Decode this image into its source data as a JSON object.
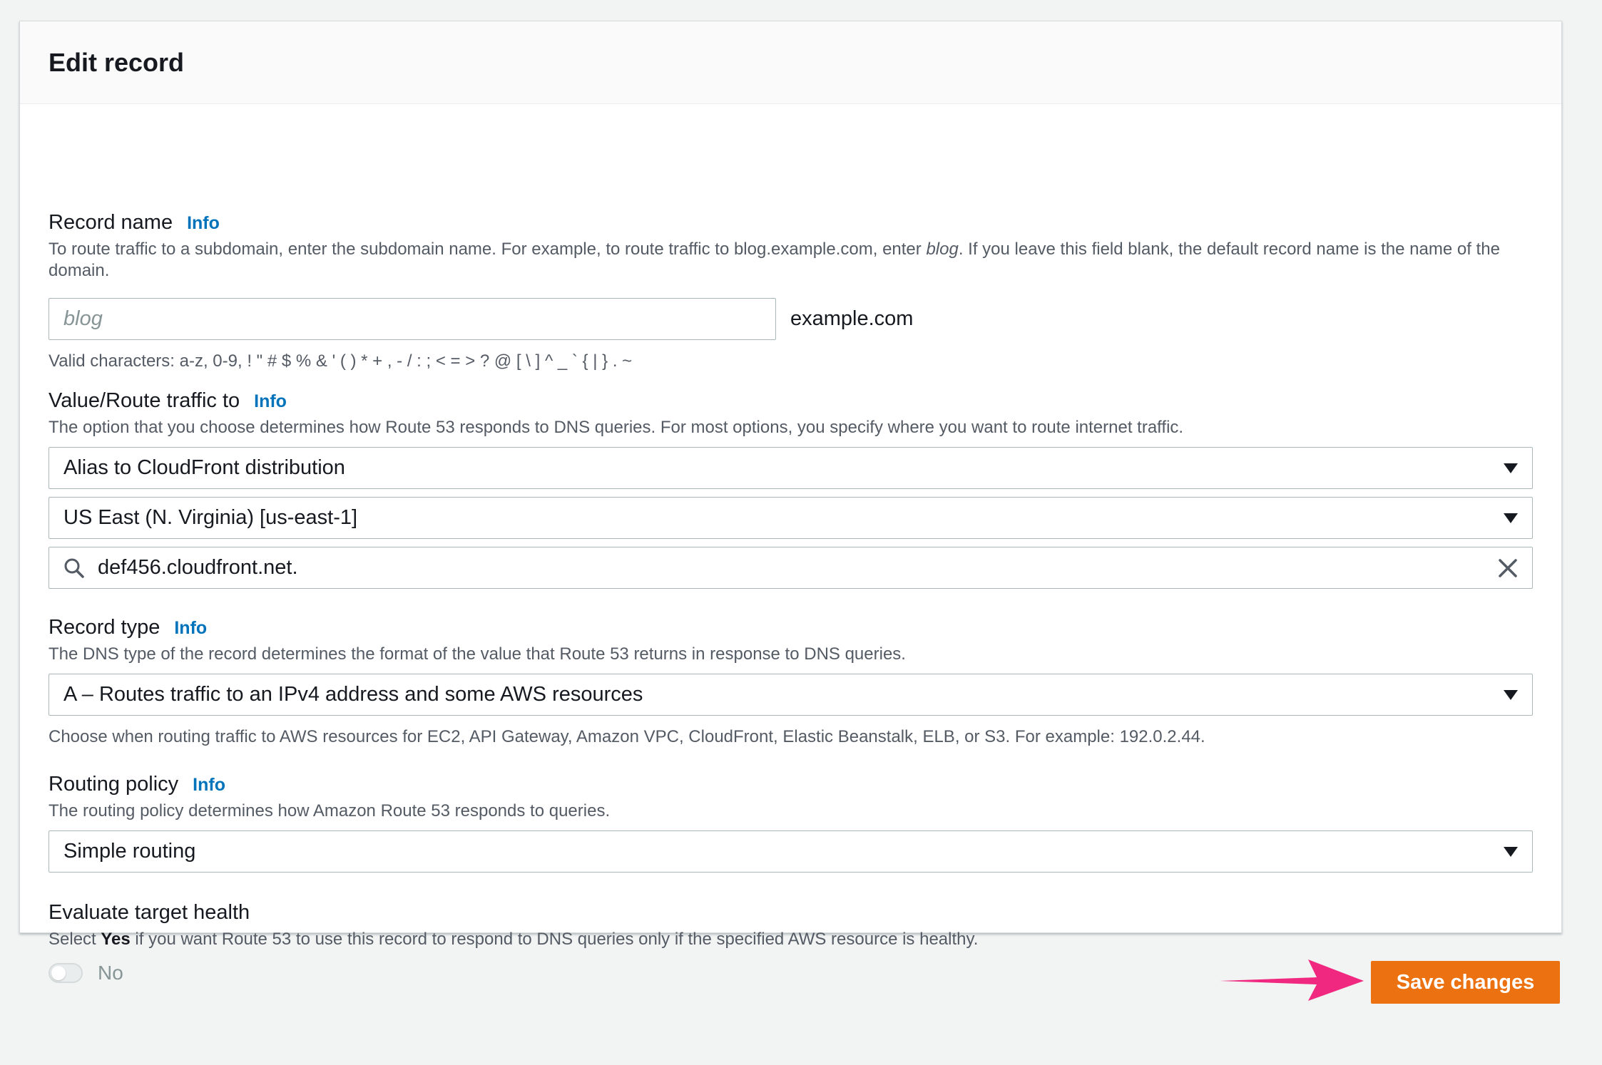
{
  "panel": {
    "title": "Edit record"
  },
  "record_name": {
    "label": "Record name",
    "info": "Info",
    "desc_before": "To route traffic to a subdomain, enter the subdomain name. For example, to route traffic to blog.example.com, enter ",
    "desc_em": "blog",
    "desc_after": ". If you leave this field blank, the default record name is the name of the domain.",
    "placeholder": "blog",
    "suffix": "example.com",
    "hint": "Valid characters: a-z, 0-9, ! \" # $ % & ' ( ) * + , - / : ; < = > ? @ [ \\ ] ^ _ ` { | } . ~"
  },
  "value_route": {
    "label": "Value/Route traffic to",
    "info": "Info",
    "desc": "The option that you choose determines how Route 53 responds to DNS queries. For most options, you specify where you want to route internet traffic.",
    "endpoint_select": "Alias to CloudFront distribution",
    "region_select": "US East (N. Virginia) [us-east-1]",
    "search_value": "def456.cloudfront.net."
  },
  "record_type": {
    "label": "Record type",
    "info": "Info",
    "desc": "The DNS type of the record determines the format of the value that Route 53 returns in response to DNS queries.",
    "selected": "A – Routes traffic to an IPv4 address and some AWS resources",
    "hint": "Choose when routing traffic to AWS resources for EC2, API Gateway, Amazon VPC, CloudFront, Elastic Beanstalk, ELB, or S3. For example: 192.0.2.44."
  },
  "routing_policy": {
    "label": "Routing policy",
    "info": "Info",
    "desc": "The routing policy determines how Amazon Route 53 responds to queries.",
    "selected": "Simple routing"
  },
  "evaluate_health": {
    "label": "Evaluate target health",
    "desc_before": "Select ",
    "desc_bold": "Yes",
    "desc_after": " if you want Route 53 to use this record to respond to DNS queries only if the specified AWS resource is healthy.",
    "toggle_label": "No"
  },
  "actions": {
    "save_label": "Save changes"
  },
  "colors": {
    "accent": "#ec7211",
    "link": "#0073bb",
    "arrow": "#f0287f"
  },
  "icons": {
    "search": "search-icon",
    "clear": "close-icon",
    "dropdown": "caret-down-icon",
    "annotation": "arrow-right-icon"
  }
}
